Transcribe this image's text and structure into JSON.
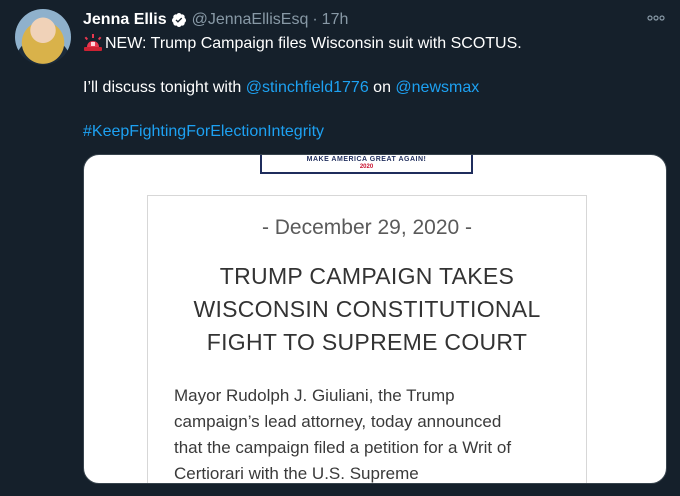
{
  "tweet": {
    "author_name": "Jenna Ellis",
    "author_handle": "@JennaEllisEsq",
    "separator": "·",
    "timestamp": "17h",
    "line1": "NEW: Trump Campaign files Wisconsin suit with SCOTUS.",
    "line2_prefix": "I’ll discuss tonight with ",
    "mention1": "@stinchfield1776",
    "line2_mid": " on ",
    "mention2": "@newsmax",
    "hashtag": "#KeepFightingForElectionIntegrity"
  },
  "card": {
    "logo_text": "MAKE AMERICA GREAT AGAIN!",
    "logo_year": "2020",
    "date": "- December 29, 2020 -",
    "headline_1": "TRUMP CAMPAIGN TAKES",
    "headline_2": "WISCONSIN CONSTITUTIONAL",
    "headline_3": "FIGHT TO SUPREME COURT",
    "body_1": "Mayor Rudolph J. Giuliani, the Trump",
    "body_2": "campaign’s lead attorney, today announced",
    "body_3": "that the campaign filed a petition for a Writ of",
    "body_4": "Certiorari with the U.S. Supreme"
  },
  "icons": {
    "verified": "verified-badge-icon",
    "more": "more-options-icon",
    "siren": "siren-emoji-icon"
  },
  "colors": {
    "background": "#15202b",
    "link": "#1da1f2",
    "muted": "#8899a6"
  }
}
